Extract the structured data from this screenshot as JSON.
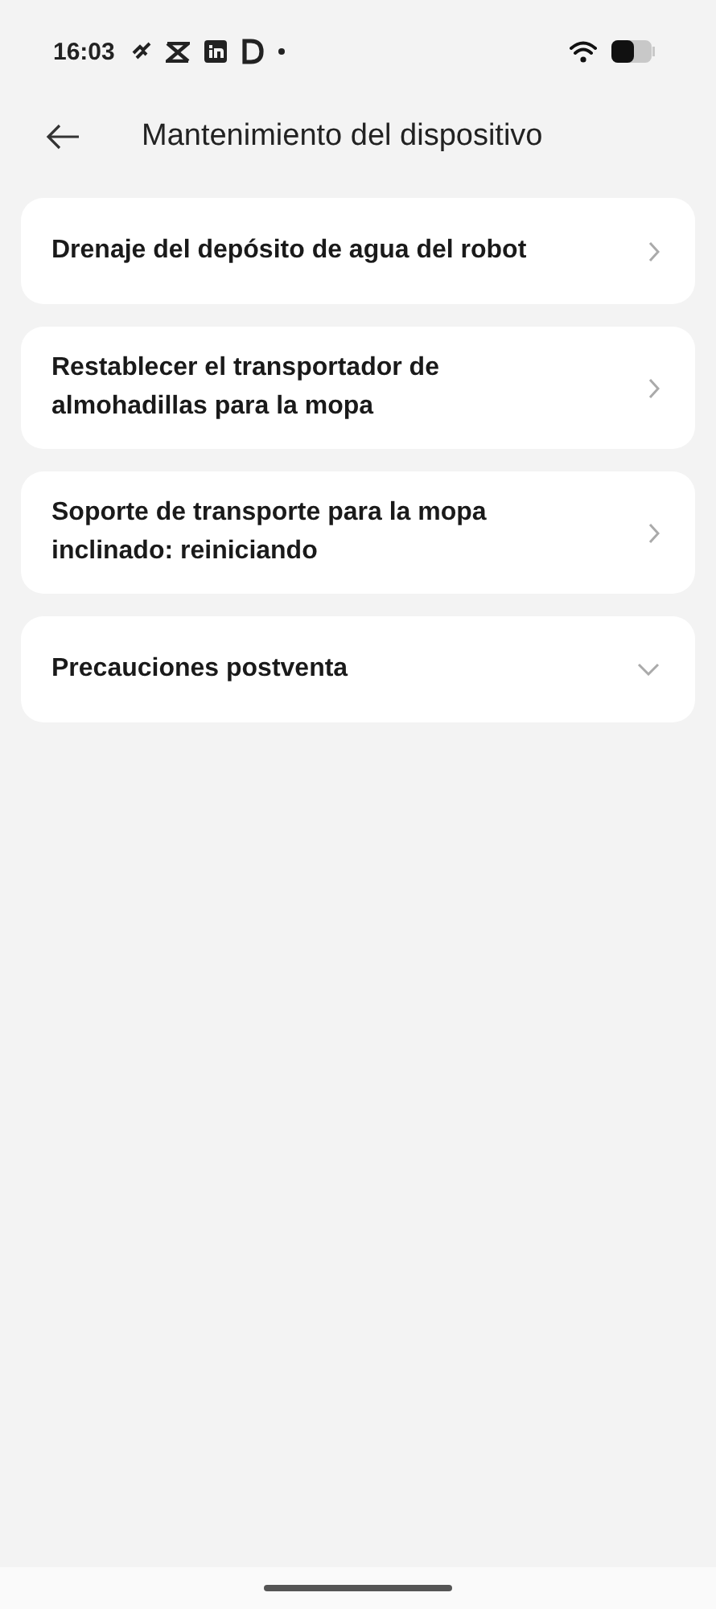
{
  "status_bar": {
    "time": "16:03"
  },
  "header": {
    "title": "Mantenimiento del dispositivo"
  },
  "items": [
    {
      "label": "Drenaje del depósito de agua del robot",
      "kind": "link"
    },
    {
      "label": "Restablecer el transportador de almohadillas para la mopa",
      "kind": "link"
    },
    {
      "label": "Soporte de transporte para la mopa inclinado: reiniciando",
      "kind": "link"
    },
    {
      "label": "Precauciones postventa",
      "kind": "dropdown"
    }
  ]
}
